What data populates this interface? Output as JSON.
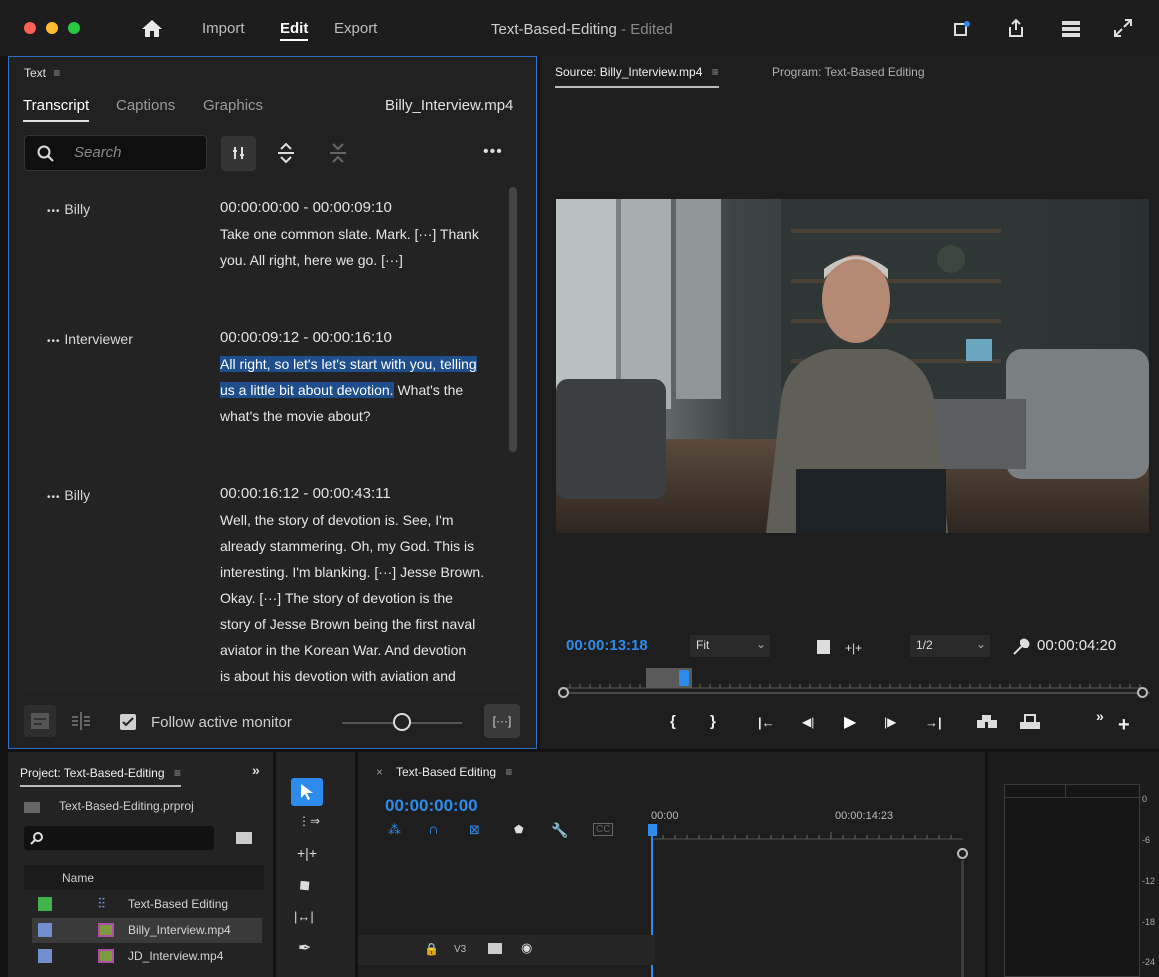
{
  "topbar": {
    "nav": [
      "Import",
      "Edit",
      "Export"
    ],
    "active": "Edit",
    "title": "Text-Based-Editing",
    "title_suffix": "- Edited"
  },
  "text_panel": {
    "title": "Text",
    "tabs": [
      "Transcript",
      "Captions",
      "Graphics"
    ],
    "active_tab": "Transcript",
    "clip": "Billy_Interview.mp4",
    "search_placeholder": "Search",
    "follow_label": "Follow active monitor",
    "ellipsis": "[···]",
    "entries": [
      {
        "speaker": "Billy",
        "time": "00:00:00:00 - 00:00:09:10",
        "lines": [
          "Take one common slate. Mark. [···] Thank",
          "you. All right, here we go. [···]"
        ]
      },
      {
        "speaker": "Interviewer",
        "time": "00:00:09:12 - 00:00:16:10",
        "sel1": "All right, so let's let's start with you, telling",
        "sel2": "us a little bit about devotion.",
        "after2": " What's the",
        "line3": "what's the movie about?"
      },
      {
        "speaker": "Billy",
        "time": "00:00:16:12 - 00:00:43:11",
        "lines": [
          "Well, the story of devotion is. See, I'm",
          "already stammering. Oh, my God. This is",
          "interesting. I'm blanking. [···] Jesse Brown.",
          "Okay. [···] The story of devotion is the",
          "story of Jesse Brown being the first naval",
          "aviator in the Korean War. And devotion",
          "is about his devotion with aviation and"
        ]
      }
    ]
  },
  "monitor": {
    "source_tab": "Source: Billy_Interview.mp4",
    "program_tab": "Program: Text-Based Editing",
    "current_time": "00:00:13:18",
    "fit": "Fit",
    "resolution": "1/2",
    "duration": "00:00:04:20",
    "playhead": 0.23
  },
  "project": {
    "title": "Project: Text-Based-Editing",
    "file": "Text-Based-Editing.prproj",
    "column": "Name",
    "items": [
      {
        "name": "Text-Based Editing",
        "color": "#3fb44a",
        "icon": "sequence-icon"
      },
      {
        "name": "Billy_Interview.mp4",
        "color": "#6f8fd1",
        "icon": "clip-icon",
        "selected": true
      },
      {
        "name": "JD_Interview.mp4",
        "color": "#6f8fd1",
        "icon": "clip-icon"
      }
    ]
  },
  "timeline": {
    "title": "Text-Based Editing",
    "timecode": "00:00:00:00",
    "ruler": [
      "00:00",
      "00:00:14:23"
    ],
    "track": "V3"
  },
  "meter": {
    "labels": [
      "0",
      "-6",
      "-12",
      "-18",
      "-24"
    ]
  }
}
